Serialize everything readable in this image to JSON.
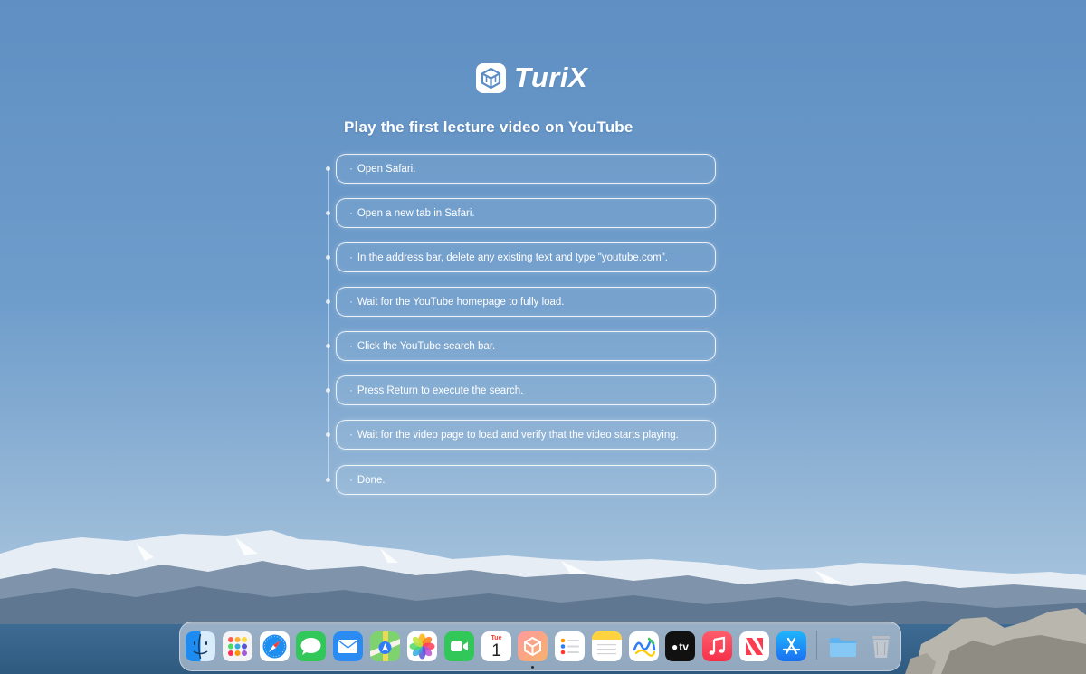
{
  "brand": {
    "name": "TuriX",
    "accent_color": "#ffffff"
  },
  "task": {
    "title": "Play the first lecture video on YouTube"
  },
  "steps": [
    {
      "bullet": "·",
      "label": "Open Safari."
    },
    {
      "bullet": "·",
      "label": "Open a new tab in Safari."
    },
    {
      "bullet": "·",
      "label": "In the address bar, delete any existing text and type \"youtube.com\"."
    },
    {
      "bullet": "·",
      "label": "Wait for the YouTube homepage to fully load."
    },
    {
      "bullet": "·",
      "label": "Click the YouTube search bar."
    },
    {
      "bullet": "·",
      "label": "Press Return to execute the search."
    },
    {
      "bullet": "·",
      "label": "Wait for the video page to load and verify that the video starts playing."
    },
    {
      "bullet": "·",
      "label": "Done."
    }
  ],
  "dock": {
    "apps": [
      {
        "name": "finder-icon"
      },
      {
        "name": "launchpad-icon"
      },
      {
        "name": "safari-icon"
      },
      {
        "name": "messages-icon"
      },
      {
        "name": "mail-icon"
      },
      {
        "name": "maps-icon"
      },
      {
        "name": "photos-icon"
      },
      {
        "name": "facetime-icon"
      },
      {
        "name": "calendar-icon",
        "month": "Tue",
        "day": "1"
      },
      {
        "name": "turix-app-icon"
      },
      {
        "name": "reminders-icon"
      },
      {
        "name": "notes-icon"
      },
      {
        "name": "freeform-icon"
      },
      {
        "name": "apple-tv-icon",
        "label": "tv"
      },
      {
        "name": "music-icon"
      },
      {
        "name": "news-icon"
      },
      {
        "name": "app-store-icon"
      },
      {
        "name": "downloads-folder-icon"
      },
      {
        "name": "trash-icon"
      }
    ]
  }
}
